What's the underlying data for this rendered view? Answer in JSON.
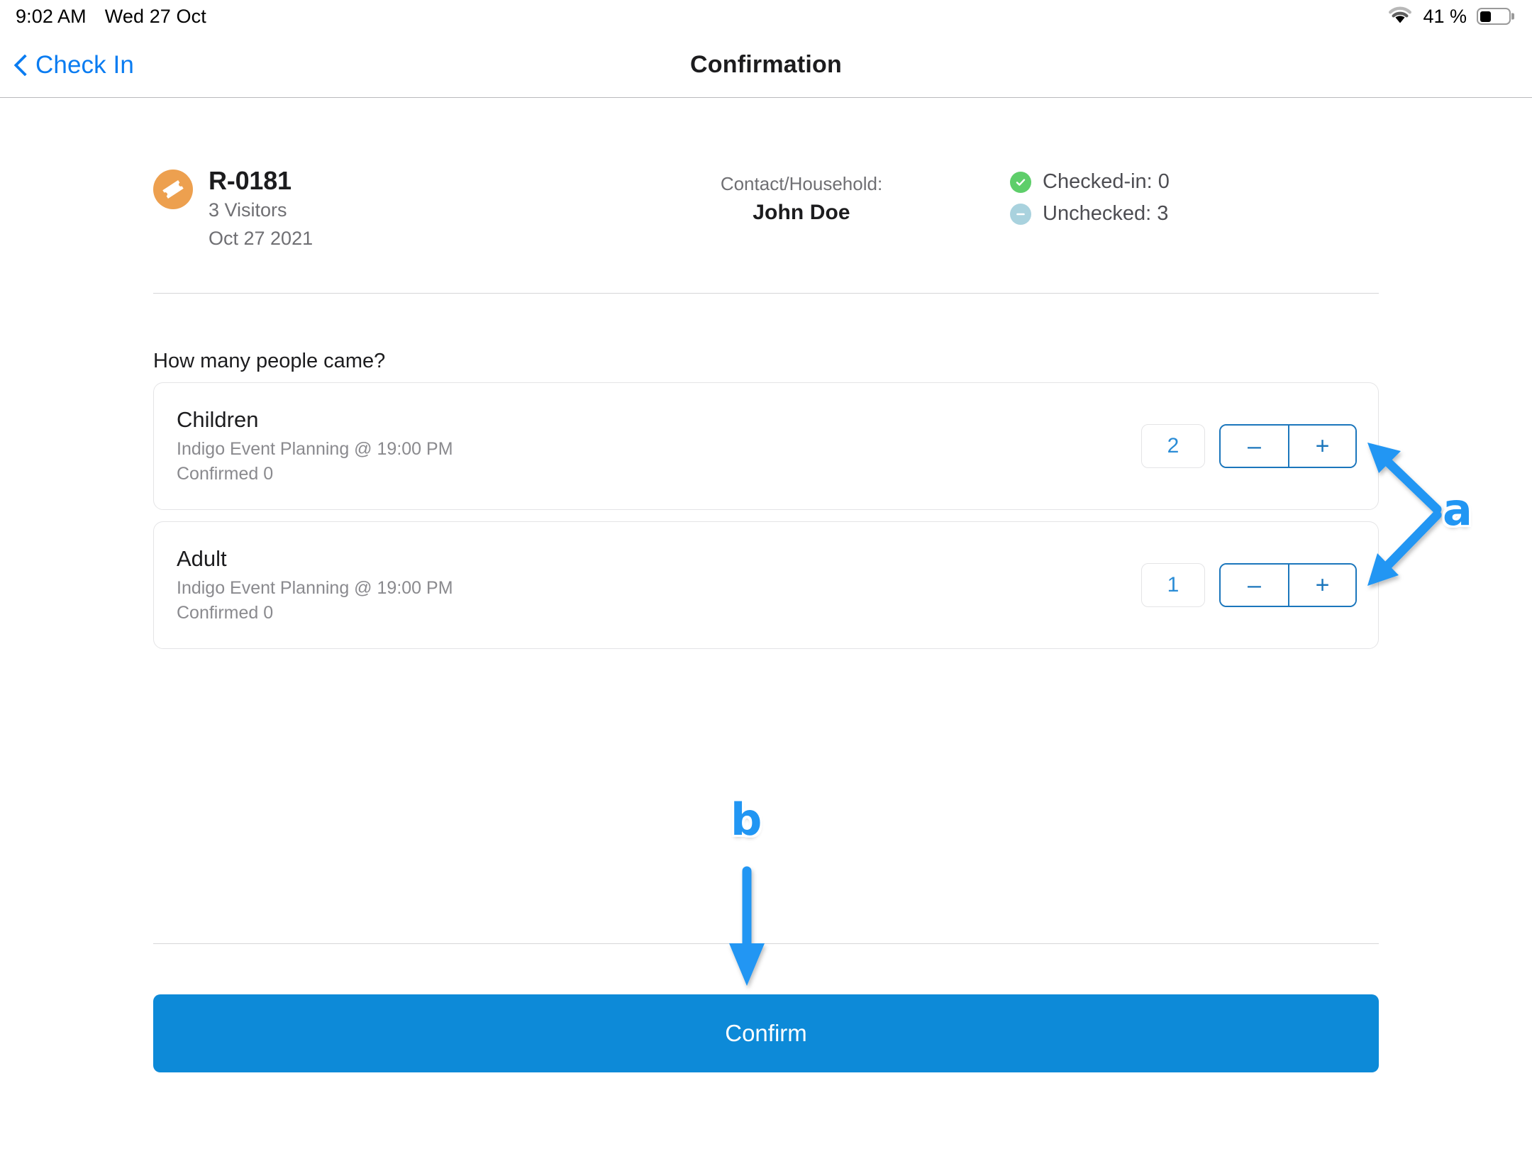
{
  "statusbar": {
    "time": "9:02 AM",
    "date": "Wed 27 Oct",
    "battery_percent": "41 %",
    "battery_level": 41,
    "wifi_icon": "wifi-icon",
    "battery_icon": "battery-icon"
  },
  "navbar": {
    "back_label": "Check In",
    "back_icon": "chevron-left-icon",
    "title": "Confirmation"
  },
  "summary": {
    "ticket_icon": "ticket-icon",
    "reservation_id": "R-0181",
    "visitors": "3 Visitors",
    "date": "Oct 27 2021",
    "contact_label": "Contact/Household:",
    "contact_name": "John Doe",
    "status": [
      {
        "icon": "check-circle-icon",
        "label": "Checked-in: 0",
        "color": "#5ece6a"
      },
      {
        "icon": "minus-circle-icon",
        "label": "Unchecked: 3",
        "color": "#a9d2de"
      }
    ]
  },
  "main": {
    "question": "How many people came?",
    "rows": [
      {
        "title": "Children",
        "meta": "Indigo Event Planning @ 19:00 PM",
        "confirmed": "Confirmed 0",
        "count": "2",
        "minus_label": "–",
        "plus_label": "+"
      },
      {
        "title": "Adult",
        "meta": "Indigo Event Planning @ 19:00 PM",
        "confirmed": "Confirmed 0",
        "count": "1",
        "minus_label": "–",
        "plus_label": "+"
      }
    ]
  },
  "footer": {
    "confirm_label": "Confirm"
  },
  "annotations": [
    {
      "label": "a",
      "target": "stepper-controls"
    },
    {
      "label": "b",
      "target": "confirm-button"
    }
  ],
  "colors": {
    "accent_blue": "#0d8ad8",
    "link_blue": "#0a7cf1",
    "stepper_blue": "#1b76bc",
    "annotation_blue": "#2196f3",
    "ticket_orange": "#eda04f",
    "checked_green": "#5ece6a",
    "unchecked_blue": "#a9d2de"
  }
}
